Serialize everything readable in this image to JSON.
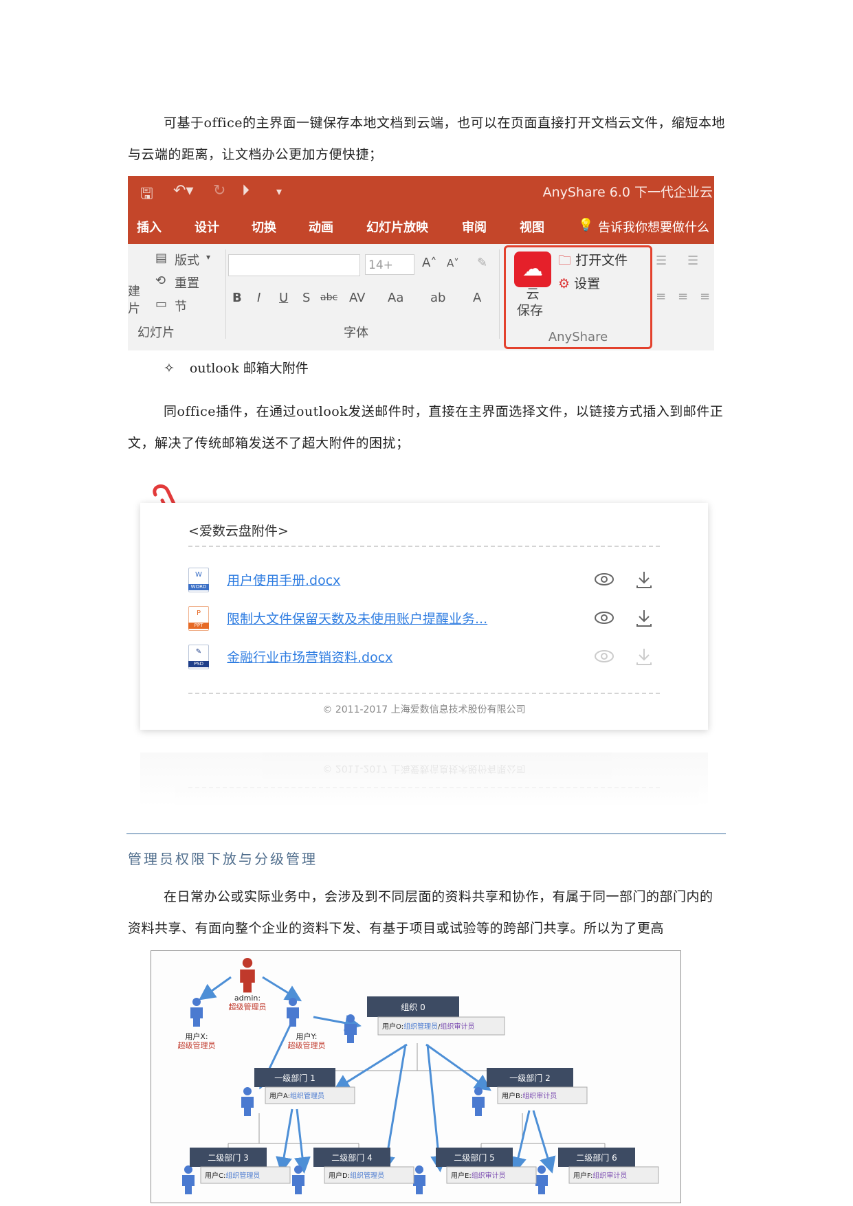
{
  "intro_paragraph": "可基于office的主界面一键保存本地文档到云端，也可以在页面直接打开文档云文件，缩短本地与云端的距离，让文档办公更加方便快捷；",
  "ribbon": {
    "app_title": "AnyShare 6.0 下一代企业云",
    "tabs": [
      "插入",
      "设计",
      "切换",
      "动画",
      "幻灯片放映",
      "审阅",
      "视图",
      "告诉我你想要做什么"
    ],
    "slides_group": {
      "layout": "版式",
      "reset": "重置",
      "section": "节",
      "label": "幻灯片",
      "new_partial": "建",
      "slide_partial": "片"
    },
    "font_group": {
      "size": "14+",
      "label": "字体"
    },
    "anyshare_group": {
      "cloud_save_1": "云",
      "cloud_save_2": "保存",
      "open_file": "打开文件",
      "settings": "设置",
      "label": "AnyShare"
    }
  },
  "bullet_item": {
    "mark": "✧",
    "text": "outlook 邮箱大附件"
  },
  "outlook_paragraph": "同office插件，在通过outlook发送邮件时，直接在主界面选择文件，以链接方式插入到邮件正文，解决了传统邮箱发送不了超大附件的困扰；",
  "attachment_card": {
    "header": "<爱数云盘附件>",
    "files": [
      {
        "name": "用户使用手册.docx",
        "type_tag": "WORD",
        "letter": "W",
        "color": "#3a6fc6",
        "enabled": true
      },
      {
        "name": "限制大文件保留天数及未使用账户提醒业务...",
        "type_tag": "PPT",
        "letter": "P",
        "color": "#e66a26",
        "enabled": true
      },
      {
        "name": "金融行业市场营销资料.docx",
        "type_tag": "PSD",
        "letter": "✎",
        "color": "#1f3f8a",
        "enabled": false
      }
    ],
    "footer": "© 2011-2017 上海爱数信息技术股份有限公司"
  },
  "section_heading": "管理员权限下放与分级管理",
  "admin_paragraph": "在日常办公或实际业务中，会涉及到不同层面的资料共享和协作，有属于同一部门的部门内的资料共享、有面向整个企业的资料下发、有基于项目或试验等的跨部门共享。所以为了更高",
  "diagram": {
    "admin": {
      "name": "admin:",
      "role": "超级管理员"
    },
    "user_x": {
      "name": "用户X:",
      "role": "超级管理员"
    },
    "user_y": {
      "name": "用户Y:",
      "role": "超级管理员"
    },
    "org0": {
      "title": "组织 0",
      "user": "用户O:",
      "role_a": "组织管理员",
      "sep": "/",
      "role_b": "组织审计员"
    },
    "dept1": {
      "title": "一级部门 1",
      "user": "用户A:",
      "role": "组织管理员"
    },
    "dept2": {
      "title": "一级部门 2",
      "user": "用户B:",
      "role": "组织审计员"
    },
    "dept3": {
      "title": "二级部门 3",
      "user": "用户C:",
      "role": "组织管理员"
    },
    "dept4": {
      "title": "二级部门 4",
      "user": "用户D:",
      "role": "组织管理员"
    },
    "dept5": {
      "title": "二级部门 5",
      "user": "用户E:",
      "role": "组织审计员"
    },
    "dept6": {
      "title": "二级部门 6",
      "user": "用户F:",
      "role": "组织审计员"
    }
  }
}
